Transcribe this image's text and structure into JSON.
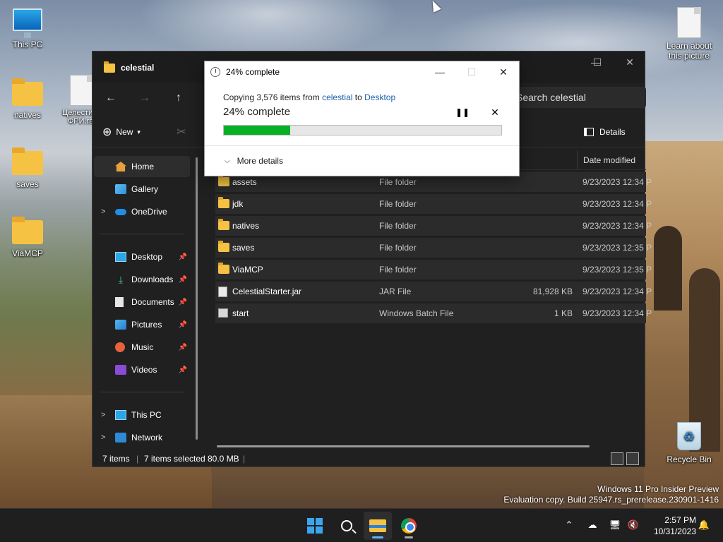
{
  "desktop": {
    "icons": [
      {
        "label": "This PC",
        "icon": "monitor-icon"
      },
      {
        "label": "natives",
        "icon": "folder-icon"
      },
      {
        "label": "Целестиал ФРИ.rar",
        "icon": "document-icon"
      },
      {
        "label": "saves",
        "icon": "folder-icon"
      },
      {
        "label": "ViaMCP",
        "icon": "folder-icon"
      },
      {
        "label": "Learn about this picture",
        "icon": "document-icon"
      },
      {
        "label": "Recycle Bin",
        "icon": "recycle-bin-icon"
      }
    ],
    "watermark": {
      "line1": "Windows 11 Pro Insider Preview",
      "line2": "Evaluation copy. Build 25947.rs_prerelease.230901-1416"
    }
  },
  "explorer": {
    "tab_title": "celestial",
    "search_text": "Search celestial",
    "toolbar": {
      "new_label": "New",
      "details_label": "Details"
    },
    "sidebar": {
      "home": "Home",
      "gallery": "Gallery",
      "onedrive": "OneDrive",
      "desktop": "Desktop",
      "downloads": "Downloads",
      "documents": "Documents",
      "pictures": "Pictures",
      "music": "Music",
      "videos": "Videos",
      "thispc": "This PC",
      "network": "Network"
    },
    "columns": {
      "date_modified": "Date modified"
    },
    "files": [
      {
        "name": "assets",
        "type": "File folder",
        "size": "",
        "date": "9/23/2023 12:34 P",
        "icon": "folder-icon"
      },
      {
        "name": "jdk",
        "type": "File folder",
        "size": "",
        "date": "9/23/2023 12:34 P",
        "icon": "folder-icon"
      },
      {
        "name": "natives",
        "type": "File folder",
        "size": "",
        "date": "9/23/2023 12:34 P",
        "icon": "folder-icon"
      },
      {
        "name": "saves",
        "type": "File folder",
        "size": "",
        "date": "9/23/2023 12:35 P",
        "icon": "folder-icon"
      },
      {
        "name": "ViaMCP",
        "type": "File folder",
        "size": "",
        "date": "9/23/2023 12:35 P",
        "icon": "folder-icon"
      },
      {
        "name": "CelestialStarter.jar",
        "type": "JAR File",
        "size": "81,928 KB",
        "date": "9/23/2023 12:34 P",
        "icon": "file-icon"
      },
      {
        "name": "start",
        "type": "Windows Batch File",
        "size": "1 KB",
        "date": "9/23/2023 12:34 P",
        "icon": "batch-file-icon"
      }
    ],
    "status": {
      "items": "7 items",
      "selected": "7 items selected",
      "size": "80.0 MB"
    }
  },
  "copy_dialog": {
    "title": "24% complete",
    "copy_prefix": "Copying 3,576 items from ",
    "source": "celestial",
    "to_word": " to ",
    "destination": "Desktop",
    "percent_label": "24% complete",
    "progress_percent": 24,
    "more_details": "More details",
    "progress_color": "#06b025"
  },
  "taskbar": {
    "time": "2:57 PM",
    "date": "10/31/2023"
  }
}
